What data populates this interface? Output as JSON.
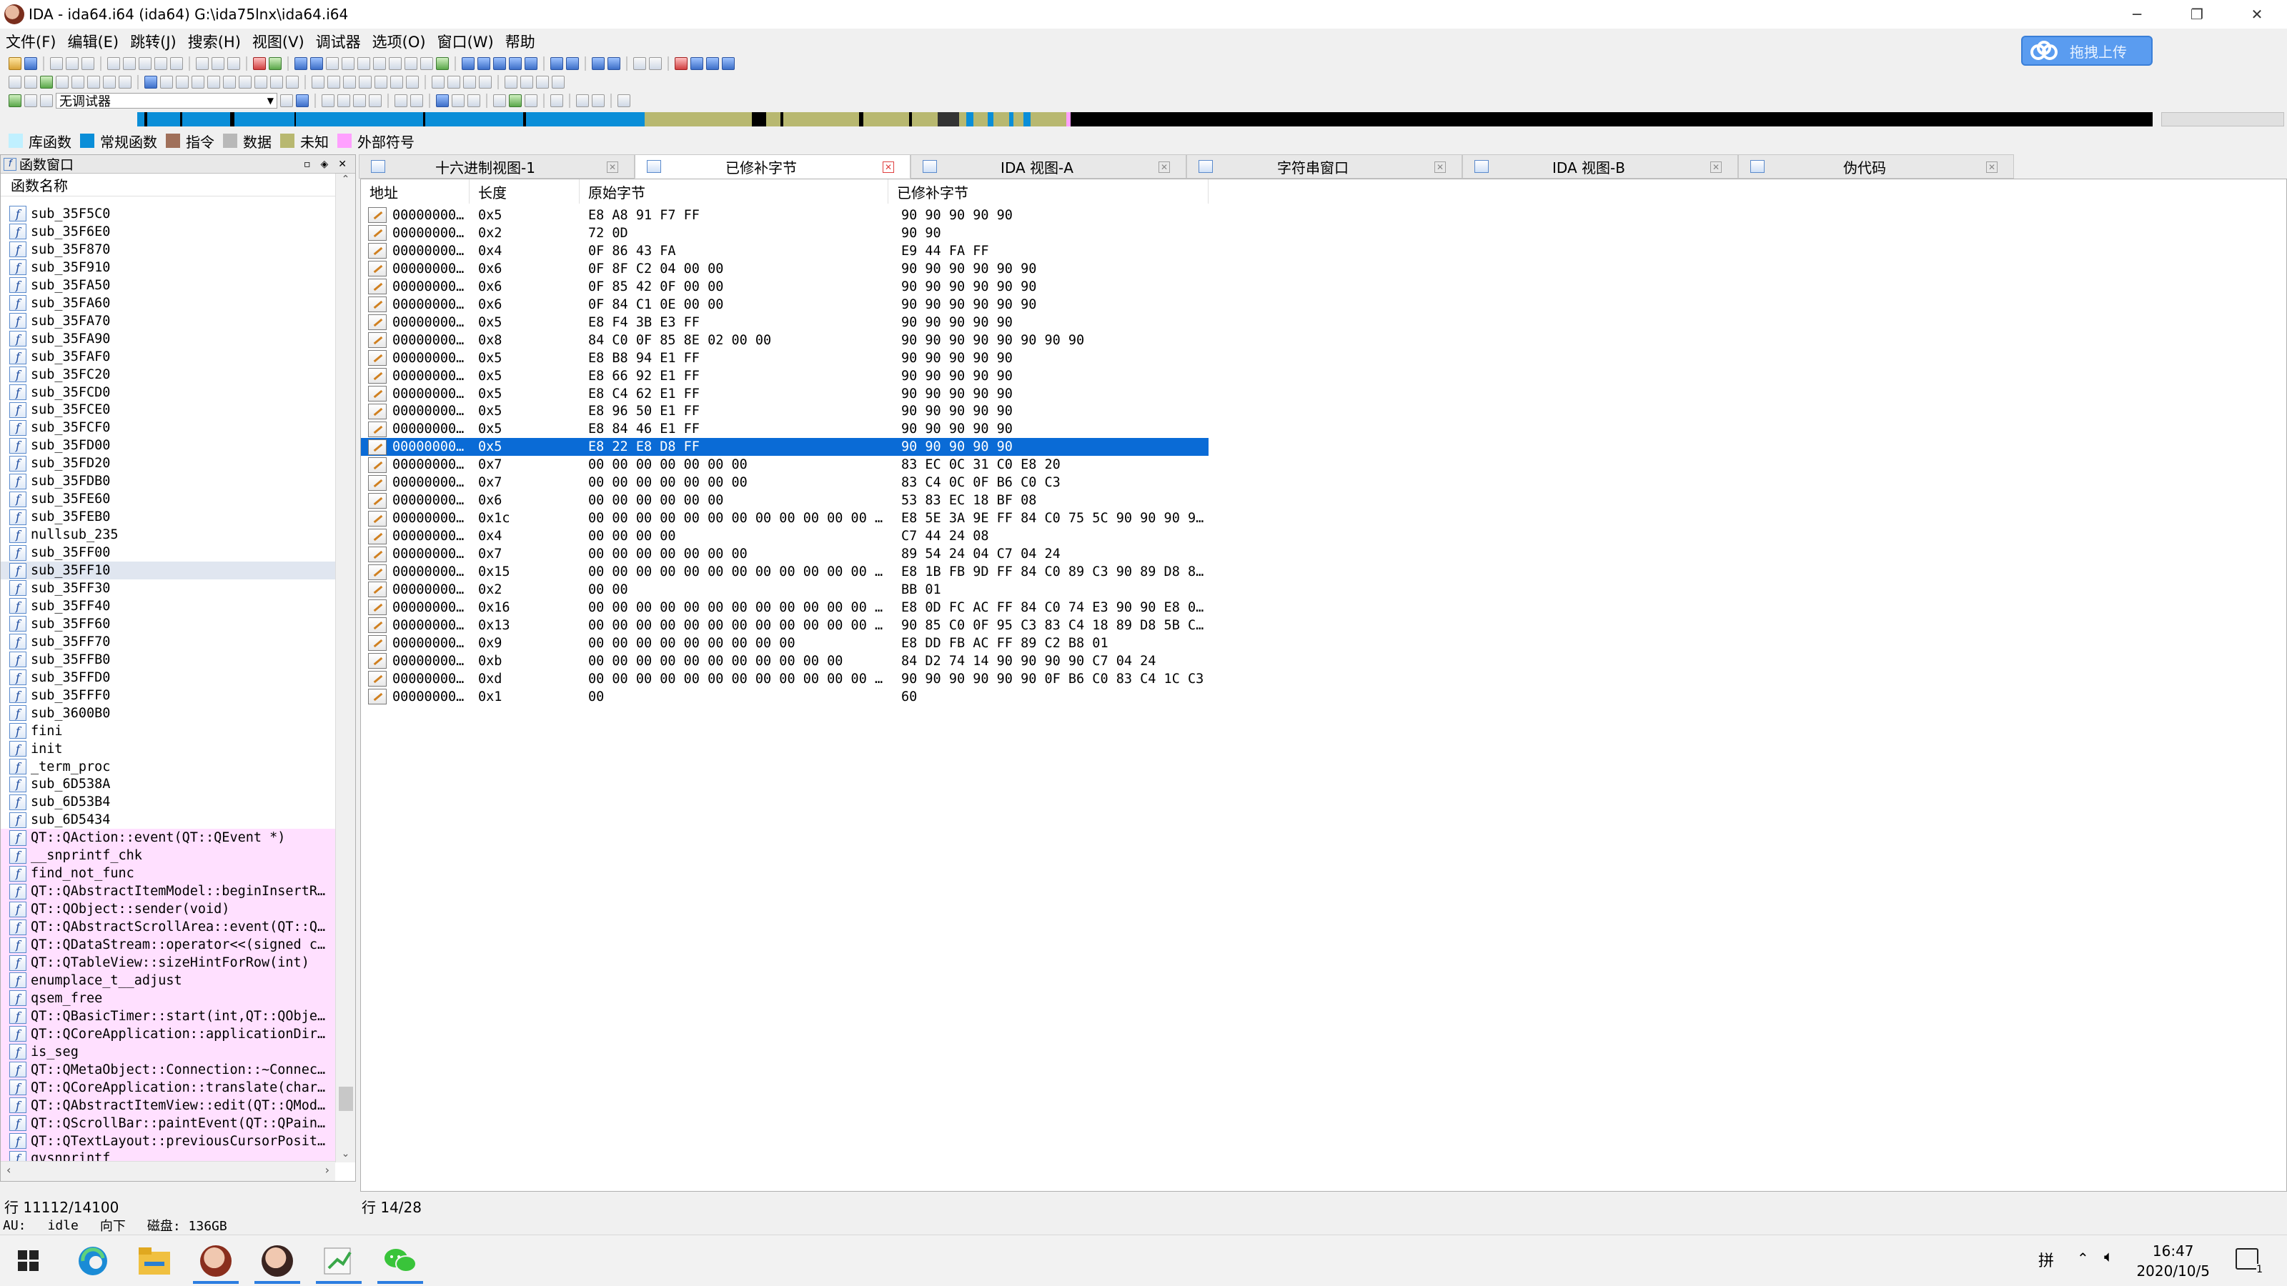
{
  "window": {
    "title": "IDA - ida64.i64 (ida64) G:\\ida75lnx\\ida64.i64",
    "minimize": "─",
    "restore": "❐",
    "close": "✕"
  },
  "upload_button": {
    "label": "拖拽上传"
  },
  "menu": [
    "文件(F)",
    "编辑(E)",
    "跳转(J)",
    "搜索(H)",
    "视图(V)",
    "调试器",
    "选项(O)",
    "窗口(W)",
    "帮助"
  ],
  "toolbar": {
    "debugger_select": "无调试器"
  },
  "legend": [
    {
      "label": "库函数",
      "color": "#c0f0ff"
    },
    {
      "label": "常规函数",
      "color": "#0a8ed8"
    },
    {
      "label": "指令",
      "color": "#a0705a"
    },
    {
      "label": "数据",
      "color": "#b8b8b8"
    },
    {
      "label": "未知",
      "color": "#b8b870"
    },
    {
      "label": "外部符号",
      "color": "#ffa0ff"
    }
  ],
  "functions_panel": {
    "title": "函数窗口",
    "column": "函数名称",
    "items": [
      {
        "name": "sub_35F5C0",
        "lib": false
      },
      {
        "name": "sub_35F6E0",
        "lib": false
      },
      {
        "name": "sub_35F870",
        "lib": false
      },
      {
        "name": "sub_35F910",
        "lib": false
      },
      {
        "name": "sub_35FA50",
        "lib": false
      },
      {
        "name": "sub_35FA60",
        "lib": false
      },
      {
        "name": "sub_35FA70",
        "lib": false
      },
      {
        "name": "sub_35FA90",
        "lib": false
      },
      {
        "name": "sub_35FAF0",
        "lib": false
      },
      {
        "name": "sub_35FC20",
        "lib": false
      },
      {
        "name": "sub_35FCD0",
        "lib": false
      },
      {
        "name": "sub_35FCE0",
        "lib": false
      },
      {
        "name": "sub_35FCF0",
        "lib": false
      },
      {
        "name": "sub_35FD00",
        "lib": false
      },
      {
        "name": "sub_35FD20",
        "lib": false
      },
      {
        "name": "sub_35FDB0",
        "lib": false
      },
      {
        "name": "sub_35FE60",
        "lib": false
      },
      {
        "name": "sub_35FEB0",
        "lib": false
      },
      {
        "name": "nullsub_235",
        "lib": false
      },
      {
        "name": "sub_35FF00",
        "lib": false
      },
      {
        "name": "sub_35FF10",
        "lib": false,
        "selected": true
      },
      {
        "name": "sub_35FF30",
        "lib": false
      },
      {
        "name": "sub_35FF40",
        "lib": false
      },
      {
        "name": "sub_35FF60",
        "lib": false
      },
      {
        "name": "sub_35FF70",
        "lib": false
      },
      {
        "name": "sub_35FFB0",
        "lib": false
      },
      {
        "name": "sub_35FFD0",
        "lib": false
      },
      {
        "name": "sub_35FFF0",
        "lib": false
      },
      {
        "name": "sub_3600B0",
        "lib": false
      },
      {
        "name": "fini",
        "lib": false
      },
      {
        "name": "init",
        "lib": false
      },
      {
        "name": "_term_proc",
        "lib": false
      },
      {
        "name": "sub_6D538A",
        "lib": false
      },
      {
        "name": "sub_6D53B4",
        "lib": false
      },
      {
        "name": "sub_6D5434",
        "lib": false
      },
      {
        "name": "QT::QAction::event(QT::QEvent *)",
        "lib": true
      },
      {
        "name": "__snprintf_chk",
        "lib": true
      },
      {
        "name": "find_not_func",
        "lib": true
      },
      {
        "name": "QT::QAbstractItemModel::beginInsertR…",
        "lib": true
      },
      {
        "name": "QT::QObject::sender(void)",
        "lib": true
      },
      {
        "name": "QT::QAbstractScrollArea::event(QT::Q…",
        "lib": true
      },
      {
        "name": "QT::QDataStream::operator<<(signed c…",
        "lib": true
      },
      {
        "name": "QT::QTableView::sizeHintForRow(int)",
        "lib": true
      },
      {
        "name": "enumplace_t__adjust",
        "lib": true
      },
      {
        "name": "qsem_free",
        "lib": true
      },
      {
        "name": "QT::QBasicTimer::start(int,QT::QObje…",
        "lib": true
      },
      {
        "name": "QT::QCoreApplication::applicationDir…",
        "lib": true
      },
      {
        "name": "is_seg",
        "lib": true
      },
      {
        "name": "QT::QMetaObject::Connection::~Connec…",
        "lib": true
      },
      {
        "name": "QT::QCoreApplication::translate(char…",
        "lib": true
      },
      {
        "name": "QT::QAbstractItemView::edit(QT::QMod…",
        "lib": true
      },
      {
        "name": "QT::QScrollBar::paintEvent(QT::QPain…",
        "lib": true
      },
      {
        "name": "QT::QTextLayout::previousCursorPosit…",
        "lib": true
      },
      {
        "name": "qvsnprintf",
        "lib": true
      }
    ]
  },
  "tabs": [
    {
      "label": "十六进制视图-1",
      "active": false
    },
    {
      "label": "已修补字节",
      "active": true
    },
    {
      "label": "IDA 视图-A",
      "active": false
    },
    {
      "label": "字符串窗口",
      "active": false
    },
    {
      "label": "IDA 视图-B",
      "active": false
    },
    {
      "label": "伪代码",
      "active": false
    }
  ],
  "patched_table": {
    "columns": {
      "address": "地址",
      "length": "长度",
      "original": "原始字节",
      "patched": "已修补字节"
    },
    "rows": [
      {
        "address": "00000000…",
        "length": "0x5",
        "original": "E8 A8 91 F7 FF",
        "patched": "90 90 90 90 90"
      },
      {
        "address": "00000000…",
        "length": "0x2",
        "original": "72 0D",
        "patched": "90 90"
      },
      {
        "address": "00000000…",
        "length": "0x4",
        "original": "0F 86 43 FA",
        "patched": "E9 44 FA FF"
      },
      {
        "address": "00000000…",
        "length": "0x6",
        "original": "0F 8F C2 04 00 00",
        "patched": "90 90 90 90 90 90"
      },
      {
        "address": "00000000…",
        "length": "0x6",
        "original": "0F 85 42 0F 00 00",
        "patched": "90 90 90 90 90 90"
      },
      {
        "address": "00000000…",
        "length": "0x6",
        "original": "0F 84 C1 0E 00 00",
        "patched": "90 90 90 90 90 90"
      },
      {
        "address": "00000000…",
        "length": "0x5",
        "original": "E8 F4 3B E3 FF",
        "patched": "90 90 90 90 90"
      },
      {
        "address": "00000000…",
        "length": "0x8",
        "original": "84 C0 0F 85 8E 02 00 00",
        "patched": "90 90 90 90 90 90 90 90"
      },
      {
        "address": "00000000…",
        "length": "0x5",
        "original": "E8 B8 94 E1 FF",
        "patched": "90 90 90 90 90"
      },
      {
        "address": "00000000…",
        "length": "0x5",
        "original": "E8 66 92 E1 FF",
        "patched": "90 90 90 90 90"
      },
      {
        "address": "00000000…",
        "length": "0x5",
        "original": "E8 C4 62 E1 FF",
        "patched": "90 90 90 90 90"
      },
      {
        "address": "00000000…",
        "length": "0x5",
        "original": "E8 96 50 E1 FF",
        "patched": "90 90 90 90 90"
      },
      {
        "address": "00000000…",
        "length": "0x5",
        "original": "E8 84 46 E1 FF",
        "patched": "90 90 90 90 90"
      },
      {
        "address": "00000000…",
        "length": "0x5",
        "original": "E8 22 E8 D8 FF",
        "patched": "90 90 90 90 90",
        "selected": true
      },
      {
        "address": "00000000…",
        "length": "0x7",
        "original": "00 00 00 00 00 00 00",
        "patched": "83 EC 0C 31 C0 E8 20"
      },
      {
        "address": "00000000…",
        "length": "0x7",
        "original": "00 00 00 00 00 00 00",
        "patched": "83 C4 0C 0F B6 C0 C3"
      },
      {
        "address": "00000000…",
        "length": "0x6",
        "original": "00 00 00 00 00 00",
        "patched": "53 83 EC 18 BF 08"
      },
      {
        "address": "00000000…",
        "length": "0x1c",
        "original": "00 00 00 00 00 00 00 00 00 00 00 00 0…",
        "patched": "E8 5E 3A 9E FF 84 C0 75 5C 90 90 90 9…"
      },
      {
        "address": "00000000…",
        "length": "0x4",
        "original": "00 00 00 00",
        "patched": "C7 44 24 08"
      },
      {
        "address": "00000000…",
        "length": "0x7",
        "original": "00 00 00 00 00 00 00",
        "patched": "89 54 24 04 C7 04 24"
      },
      {
        "address": "00000000…",
        "length": "0x15",
        "original": "00 00 00 00 00 00 00 00 00 00 00 00 0…",
        "patched": "E8 1B FB 9D FF 84 C0 89 C3 90 89 D8 8…"
      },
      {
        "address": "00000000…",
        "length": "0x2",
        "original": "00 00",
        "patched": "BB 01"
      },
      {
        "address": "00000000…",
        "length": "0x16",
        "original": "00 00 00 00 00 00 00 00 00 00 00 00 0…",
        "patched": "E8 0D FC AC FF 84 C0 74 E3 90 90 E8 0…"
      },
      {
        "address": "00000000…",
        "length": "0x13",
        "original": "00 00 00 00 00 00 00 00 00 00 00 00 0…",
        "patched": "90 85 C0 0F 95 C3 83 C4 18 89 D8 5B C…"
      },
      {
        "address": "00000000…",
        "length": "0x9",
        "original": "00 00 00 00 00 00 00 00 00",
        "patched": "E8 DD FB AC FF 89 C2 B8 01"
      },
      {
        "address": "00000000…",
        "length": "0xb",
        "original": "00 00 00 00 00 00 00 00 00 00 00",
        "patched": "84 D2 74 14 90 90 90 90 C7 04 24"
      },
      {
        "address": "00000000…",
        "length": "0xd",
        "original": "00 00 00 00 00 00 00 00 00 00 00 00 00",
        "patched": "90 90 90 90 90 90 0F B6 C0 83 C4 1C C3"
      },
      {
        "address": "00000000…",
        "length": "0x1",
        "original": "00",
        "patched": "60"
      }
    ]
  },
  "status": {
    "func_line": "行 11112/14100",
    "table_line": "行 14/28",
    "au": "AU:",
    "au_state": "idle",
    "direction": "向下",
    "disk": "磁盘: 136GB"
  },
  "taskbar": {
    "ime": "拼",
    "time": "16:47",
    "date": "2020/10/5",
    "notification_count": "1"
  }
}
